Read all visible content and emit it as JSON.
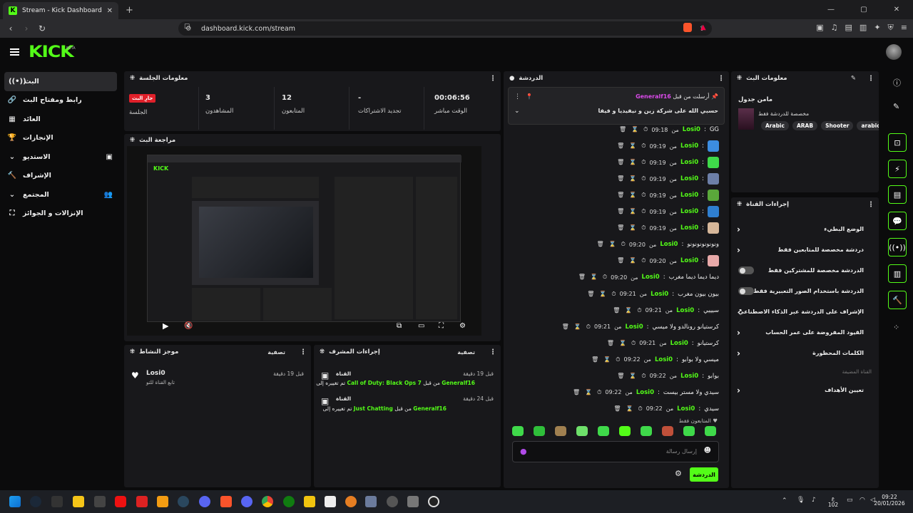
{
  "browser": {
    "tab_title": "Stream - Kick Dashboard",
    "url": "dashboard.kick.com/stream",
    "close": "✕",
    "new_tab": "+",
    "min": "—",
    "max": "▢",
    "win_close": "✕"
  },
  "kick": {
    "logo": "KICK",
    "beta": "BETA"
  },
  "sidebar": {
    "items": [
      {
        "label": "البث",
        "icon": "((•))"
      },
      {
        "label": "رابط ومفتاح البث",
        "icon": "🔗"
      },
      {
        "label": "العائد",
        "icon": "▦"
      },
      {
        "label": "الإنجازات",
        "icon": "🏆"
      },
      {
        "label": "الاستديو",
        "icon": "▣",
        "chevron": "⌄"
      },
      {
        "label": "الإشراف",
        "icon": "🔨"
      },
      {
        "label": "المجتمع",
        "icon": "👥",
        "chevron": "⌄"
      },
      {
        "label": "الإنزالات و الجوائز",
        "icon": "⛶"
      }
    ]
  },
  "session": {
    "title": "معلومات الجلسة",
    "stats": [
      {
        "value": "00:06:56",
        "label": "الوقت مباشر"
      },
      {
        "value": "-",
        "label": "تجديد الاشتراكات"
      },
      {
        "value": "12",
        "label": "المتابعون"
      },
      {
        "value": "3",
        "label": "المشاهدون"
      }
    ],
    "live_badge": "جارِ البث",
    "session_label": "الجلسة"
  },
  "preview": {
    "title": "مراجعة البث"
  },
  "activity": {
    "title": "موجز النشاط",
    "filter": "تصفية",
    "items": [
      {
        "user": "Losi0",
        "text": "تابع القناة للتو",
        "time": "قبل 19 دقيقة"
      }
    ]
  },
  "modactions": {
    "title": "إجراءات المشرف",
    "filter": "تصفية",
    "items": [
      {
        "head": "القناة",
        "time": "قبل 19 دقيقة",
        "by": "Generalf16",
        "game": "Call of Duty: Black Ops 7",
        "pre": "من قبل",
        "post": "تم تغييره إلى"
      },
      {
        "head": "القناة",
        "time": "قبل 24 دقيقة",
        "by": "Generalf16",
        "game": "Just Chatting",
        "pre": "من قبل",
        "post": "تم تغييره إلى"
      }
    ]
  },
  "chat": {
    "title": "الدردشة",
    "pinned": {
      "sent_by": "أرسلت من قبل",
      "user": "Generalf16",
      "text": "حسبي الله على شركة زين و نيفيديا و فيفا"
    },
    "messages": [
      {
        "time": "09:18",
        "user": "Losi0",
        "msg": "GG"
      },
      {
        "time": "09:19",
        "user": "Losi0",
        "emote": "#3c8de0"
      },
      {
        "time": "09:19",
        "user": "Losi0",
        "emote": "#3fd94a"
      },
      {
        "time": "09:19",
        "user": "Losi0",
        "emote": "#6d7fa8"
      },
      {
        "time": "09:19",
        "user": "Losi0",
        "emote": "#5aa83a"
      },
      {
        "time": "09:19",
        "user": "Losi0",
        "emote": "#2f7fd0"
      },
      {
        "time": "09:19",
        "user": "Losi0",
        "emote": "#d6b79a"
      },
      {
        "time": "09:20",
        "user": "Losi0",
        "msg": "ونونونونونونو"
      },
      {
        "time": "09:20",
        "user": "Losi0",
        "emote": "#e8a9a9"
      },
      {
        "time": "09:20",
        "user": "Losi0",
        "msg": "ديما ديما ديما مغرب"
      },
      {
        "time": "09:21",
        "user": "Losi0",
        "msg": "بيون بيون مغرب"
      },
      {
        "time": "09:21",
        "user": "Losi0",
        "msg": "سيييي"
      },
      {
        "time": "09:21",
        "user": "Losi0",
        "msg": "كرستيانو رونالدو ولا ميسي"
      },
      {
        "time": "09:21",
        "user": "Losi0",
        "msg": "كرستيانو"
      },
      {
        "time": "09:22",
        "user": "Losi0",
        "msg": "ميسي ولا بوابو"
      },
      {
        "time": "09:22",
        "user": "Losi0",
        "msg": "بوابو"
      },
      {
        "time": "09:22",
        "user": "Losi0",
        "msg": "سيدي ولا مستر بيست"
      },
      {
        "time": "09:22",
        "user": "Losi0",
        "msg": "سيدي"
      }
    ],
    "sep": "من",
    "followers_only": "المتابعون فقط",
    "input_placeholder": "إرسال رسالة",
    "send": "الدردشة"
  },
  "info": {
    "title": "معلومات البث",
    "name": "مامن جدول",
    "sub": "مخصصة للدردشة فقط",
    "tags": [
      "Arabic",
      "ARAB",
      "Shooter",
      "arabic"
    ]
  },
  "actions": {
    "title": "إجراءات القناة",
    "rows": [
      {
        "label": "الوضع البطيء",
        "type": "chevron"
      },
      {
        "label": "دردشة مخصصة للمتابعين فقط",
        "type": "chevron"
      },
      {
        "label": "الدردشة مخصصة للمشتركين فقط",
        "type": "toggle"
      },
      {
        "label": "الدردشة باستخدام الصور التعبيرية فقط",
        "type": "toggle"
      },
      {
        "label": "الإشراف على الدردشة عبر الذكاء الاصطناعي",
        "type": "link"
      },
      {
        "label": "القيود المفروضة على عمر الحساب",
        "type": "chevron"
      },
      {
        "label": "الكلمات المحظورة",
        "type": "chevron"
      }
    ],
    "section": "القناة المضيفة",
    "goals": "تعيين الأهداف"
  },
  "taskbar": {
    "time": "09:22",
    "date": "20/01/2026",
    "lang": "ع",
    "num": "102"
  },
  "colors": {
    "accent": "#53fc18",
    "live": "#e0202a",
    "panel": "#18181b"
  }
}
